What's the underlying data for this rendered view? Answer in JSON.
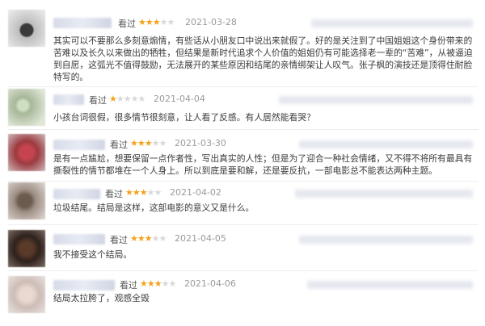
{
  "reviews": [
    {
      "seen": "看过",
      "rating": 3,
      "date": "2021-03-28",
      "text": "其实可以不要那么多刻意煽情，有些话从小朋友口中说出来就假了。好的是关注到了中国姐姐这个身份带来的苦难以及长久以来做出的牺牲，但结果是新时代追求个人价值的姐姐仍有可能选择老一辈的“苦难”，从被逼迫到自愿，这弧光不值得鼓励，无法展开的某些原因和结尾的亲情绑架让人叹气。张子枫的演技还是顶得住耐脸特写的。"
    },
    {
      "seen": "看过",
      "rating": 1,
      "date": "2021-04-04",
      "text": "小孩台词很假，很多情节很刻意，让人看了反感。有人居然能看哭？"
    },
    {
      "seen": "看过",
      "rating": 3,
      "date": "2021-03-30",
      "text": "是有一点尴尬，想要保留一点作者性，写出真实的人性；但是为了迎合一种社会情绪，又不得不将所有最具有撕裂性的情节都堆在一个人身上。所以到底是要和解，还是要反抗，一部电影总不能表达两种主题。"
    },
    {
      "seen": "看过",
      "rating": 3,
      "date": "2021-04-02",
      "text": "垃圾结尾。结局是这样，这部电影的意义又是什么。"
    },
    {
      "seen": "看过",
      "rating": 3,
      "date": "2021-04-05",
      "text": "我不接受这个结局。"
    },
    {
      "seen": "看过",
      "rating": 3,
      "date": "2021-04-06",
      "text": "结局太拉胯了，观感全毁"
    }
  ],
  "colors": {
    "star_on": "#f4a21b",
    "star_off": "#d8d8d8",
    "date": "#9a9a9a",
    "text": "#3a3a3a"
  }
}
